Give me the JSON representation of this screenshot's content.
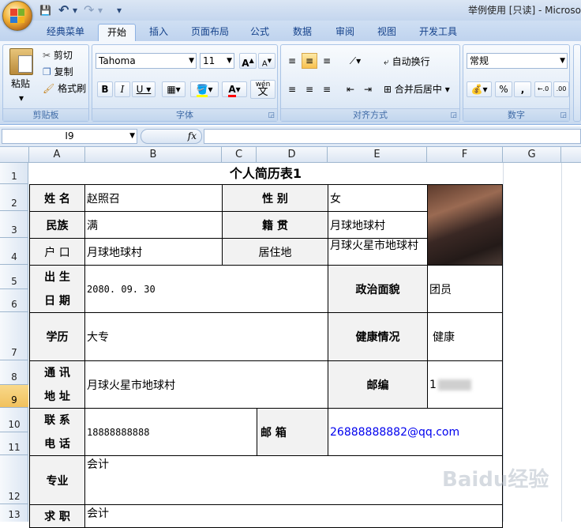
{
  "window": {
    "title": "举例使用  [只读] - Microso"
  },
  "qat": {
    "save": "💾",
    "undo": "↶",
    "redo": "↷",
    "more": "▾"
  },
  "tabs": [
    {
      "label": "经典菜单",
      "active": false
    },
    {
      "label": "开始",
      "active": true
    },
    {
      "label": "插入",
      "active": false
    },
    {
      "label": "页面布局",
      "active": false
    },
    {
      "label": "公式",
      "active": false
    },
    {
      "label": "数据",
      "active": false
    },
    {
      "label": "审阅",
      "active": false
    },
    {
      "label": "视图",
      "active": false
    },
    {
      "label": "开发工具",
      "active": false
    }
  ],
  "ribbon": {
    "clipboard": {
      "label": "剪贴板",
      "paste": "粘贴",
      "cut": "剪切",
      "copy": "复制",
      "format_painter": "格式刷"
    },
    "font": {
      "label": "字体",
      "name": "Tahoma",
      "size": "11",
      "grow": "A",
      "shrink": "A",
      "bold": "B",
      "italic": "I",
      "underline": "U",
      "wen": "wén",
      "wen_char": "文"
    },
    "alignment": {
      "label": "对齐方式",
      "wrap": "自动换行",
      "merge": "合并后居中"
    },
    "number": {
      "label": "数字",
      "format": "常规",
      "percent": "%",
      "comma": ","
    }
  },
  "formula_bar": {
    "name_box": "I9",
    "fx": "fx",
    "content": ""
  },
  "columns": [
    "A",
    "B",
    "C",
    "D",
    "E",
    "F",
    "G"
  ],
  "rows": [
    "1",
    "2",
    "3",
    "4",
    "5",
    "6",
    "7",
    "8",
    "9",
    "10",
    "11",
    "12",
    "13"
  ],
  "selected": {
    "row": "9",
    "col": "I"
  },
  "resume": {
    "title": "个人简历表1",
    "name_label": "姓  名",
    "name": "赵照召",
    "gender_label": "性  别",
    "gender": "女",
    "ethnicity_label": "民族",
    "ethnicity": "满",
    "origin_label": "籍  贯",
    "origin": "月球地球村",
    "hukou_label": "户  口",
    "hukou": "月球地球村",
    "residence_label": "居住地",
    "residence": "月球火星市地球村",
    "birth_label_1": "出  生",
    "birth_label_2": "日  期",
    "birth": "2080. 09. 30",
    "political_label": "政治面貌",
    "political": "团员",
    "education_label": "学历",
    "education": "大专",
    "health_label": "健康情况",
    "health": "健康",
    "address_label_1": "通  讯",
    "address_label_2": "地  址",
    "address": "月球火星市地球村",
    "postcode_label": "邮编",
    "postcode": "1",
    "phone_label_1": "联  系",
    "phone_label_2": "电  话",
    "phone": "18888888888",
    "email_label": "邮  箱",
    "email": "26888888882@qq.com",
    "major_label": "专业",
    "major": "会计",
    "job_label": "求  职",
    "job": "会计"
  },
  "watermark": "Baidu经验"
}
